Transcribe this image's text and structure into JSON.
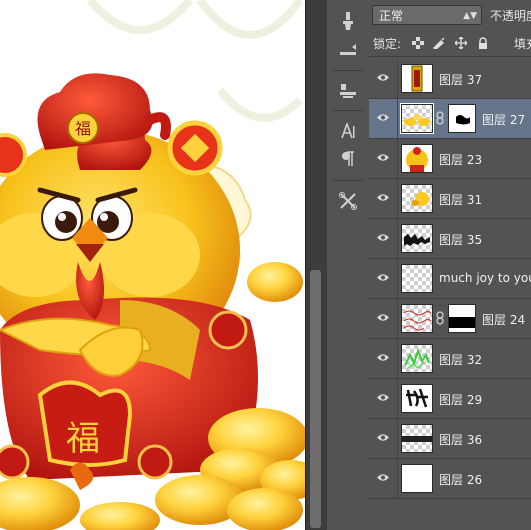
{
  "window": {
    "title": ""
  },
  "blend_mode": {
    "value": "正常"
  },
  "opacity_label": "不透明度",
  "lock": {
    "label": "锁定:",
    "fill_label": "填充"
  },
  "layers": [
    {
      "name": "图层 37",
      "visible": true,
      "selected": false,
      "has_mask": false,
      "thumb": "gold-plaque-icon"
    },
    {
      "name": "图层 27",
      "visible": true,
      "selected": true,
      "has_mask": true,
      "thumb": "ingots-icon"
    },
    {
      "name": "图层 23",
      "visible": true,
      "selected": false,
      "has_mask": false,
      "thumb": "rooster-icon"
    },
    {
      "name": "图层 31",
      "visible": true,
      "selected": false,
      "has_mask": false,
      "thumb": "gold-blob-icon"
    },
    {
      "name": "图层 35",
      "visible": true,
      "selected": false,
      "has_mask": false,
      "thumb": "black-pattern-icon"
    },
    {
      "name": "much joy to you i",
      "visible": true,
      "selected": false,
      "has_mask": false,
      "thumb": "text-layer-icon"
    },
    {
      "name": "图层 24",
      "visible": true,
      "selected": false,
      "has_mask": true,
      "thumb": "red-pattern-icon"
    },
    {
      "name": "图层 32",
      "visible": true,
      "selected": false,
      "has_mask": false,
      "thumb": "green-pattern-icon"
    },
    {
      "name": "图层 29",
      "visible": true,
      "selected": false,
      "has_mask": false,
      "thumb": "calligraphy-icon"
    },
    {
      "name": "图层 36",
      "visible": true,
      "selected": false,
      "has_mask": false,
      "thumb": "dark-stripe-icon"
    },
    {
      "name": "图层 26",
      "visible": true,
      "selected": false,
      "has_mask": false,
      "thumb": "white-layer-icon"
    }
  ],
  "canvas": {
    "badge_char": "福",
    "belly_char": "福",
    "coin_char": "◆"
  },
  "colors": {
    "panel_bg": "#535353",
    "selected_layer": "#66758a",
    "rooster_yellow": "#f6c31a",
    "rooster_red": "#d3241b",
    "gold": "#ffd23c"
  }
}
